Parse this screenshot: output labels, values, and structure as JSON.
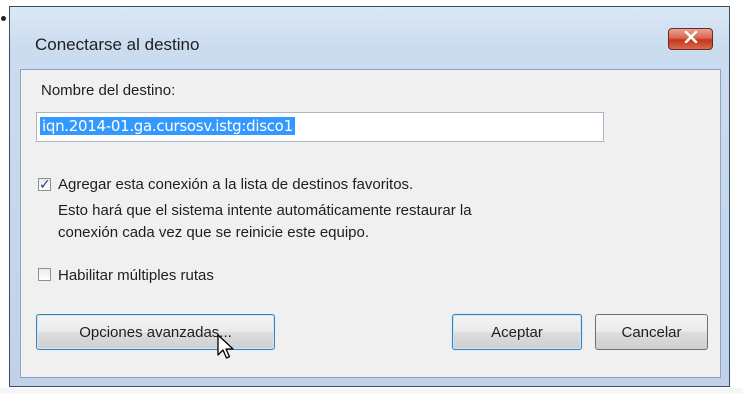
{
  "dialog": {
    "title": "Conectarse al destino",
    "close_icon": "close-icon",
    "target_label": "Nombre del destino:",
    "target_value": "iqn.2014-01.ga.cursosv.istg:disco1",
    "favorites": {
      "checked": true,
      "label": "Agregar esta conexión a la lista de destinos favoritos.",
      "description_line1": "Esto hará que el sistema intente automáticamente restaurar la",
      "description_line2": "conexión cada vez que se reinicie este equipo."
    },
    "multipath": {
      "checked": false,
      "label": "Habilitar múltiples rutas"
    },
    "buttons": {
      "advanced": "Opciones avanzadas...",
      "ok": "Aceptar",
      "cancel": "Cancelar"
    }
  },
  "colors": {
    "frame": "#cbdcef",
    "close": "#c5361b",
    "selection": "#3399ff"
  }
}
